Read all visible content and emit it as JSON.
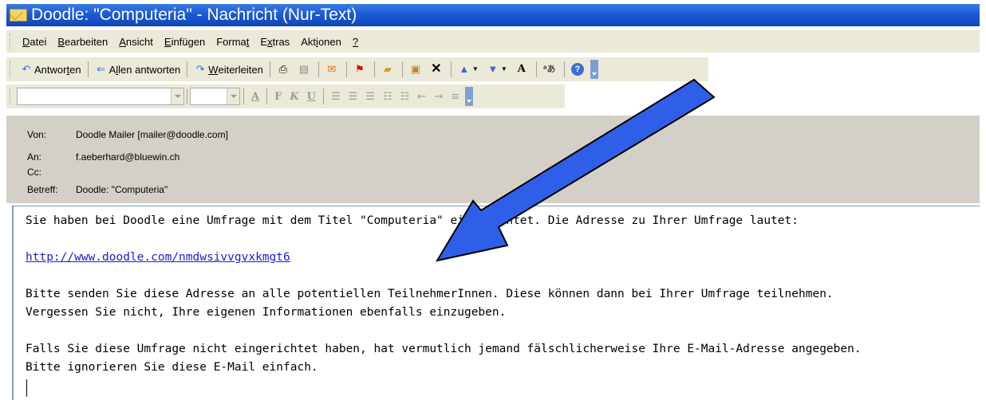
{
  "window": {
    "title": "Doodle: \"Computeria\" - Nachricht (Nur-Text)"
  },
  "menubar": {
    "items": [
      {
        "pre": "",
        "u": "D",
        "post": "atei"
      },
      {
        "pre": "",
        "u": "B",
        "post": "earbeiten"
      },
      {
        "pre": "",
        "u": "A",
        "post": "nsicht"
      },
      {
        "pre": "",
        "u": "E",
        "post": "infügen"
      },
      {
        "pre": "Forma",
        "u": "t",
        "post": ""
      },
      {
        "pre": "E",
        "u": "x",
        "post": "tras"
      },
      {
        "pre": "Akt",
        "u": "i",
        "post": "onen"
      },
      {
        "pre": "",
        "u": "?",
        "post": ""
      }
    ]
  },
  "toolbar": {
    "reply": {
      "pre": "Antwor",
      "u": "t",
      "post": "en"
    },
    "reply_all": {
      "pre": "A",
      "u": "l",
      "post": "len antworten"
    },
    "forward": {
      "pre": "",
      "u": "W",
      "post": "eiterleiten"
    }
  },
  "header": {
    "from_label": "Von:",
    "from_value": "Doodle Mailer [mailer@doodle.com]",
    "to_label": "An:",
    "to_value": "f.aeberhard@bluewin.ch",
    "cc_label": "Cc:",
    "cc_value": "",
    "subject_label": "Betreff:",
    "subject_value": "Doodle: \"Computeria\""
  },
  "body": {
    "line1": "Sie haben bei Doodle eine Umfrage mit dem Titel \"Computeria\" eingerichtet. Die Adresse zu Ihrer Umfrage lautet:",
    "link": "http://www.doodle.com/nmdwsivvgvxkmgt6",
    "line3": "Bitte senden Sie diese Adresse an alle potentiellen TeilnehmerInnen. Diese können dann bei Ihrer Umfrage teilnehmen.",
    "line4": "Vergessen Sie nicht, Ihre eigenen Informationen ebenfalls einzugeben.",
    "line5": "Falls Sie diese Umfrage nicht eingerichtet haben, hat vermutlich jemand fälschlicherweise Ihre E-Mail-Adresse angegeben.",
    "line6": "Bitte ignorieren Sie diese E-Mail einfach."
  },
  "colors": {
    "titlebar": "#1d5bd6",
    "chrome": "#ece9d8",
    "header_bg": "#d4d0c8",
    "arrow_fill": "#2f5fe8",
    "link": "#1a1ad8"
  }
}
